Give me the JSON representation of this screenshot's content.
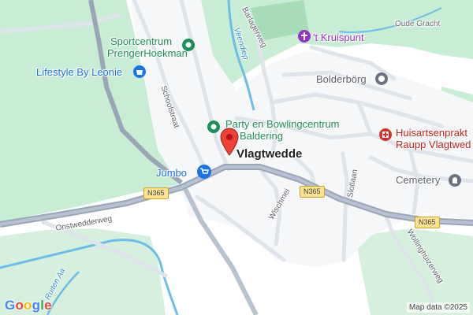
{
  "map": {
    "colors": {
      "land": "#ffffff",
      "park": "#c8edd4",
      "road": "#dfe3ea",
      "major_road": "#9aa6b8",
      "water": "#6cbde9"
    },
    "town_label": "Vlagtwedde",
    "pois": {
      "sportcentrum_line1": "Sportcentrum",
      "sportcentrum_line2": "PrengerHoekman",
      "lifestyle": "Lifestyle By Leonie",
      "kruispunt": "'t Kruispunt",
      "bolderborg": "Bolderbörg",
      "party_line1": "Party en Bowlingcentrum",
      "party_line2": "Baldering",
      "huisarts_line1": "Huisartsenprakt",
      "huisarts_line2": "Raupp Vlagtwed",
      "jumbo": "Jumbo",
      "cemetery": "Cemetery"
    },
    "streets": {
      "schoolstraat": "Schoolstraat",
      "barlagerweg": "Barlagerweg",
      "onstwedderweg": "Onstwedderweg",
      "wischmei": "Wischmei",
      "slotlaan": "Slotlaan",
      "wollinghuizerweg": "Wollinghuizerweg",
      "oude_gracht": "Oude Gracht"
    },
    "water_labels": {
      "veendiep": "Veendiep",
      "ruiten_aa": "Ruiten Aa"
    },
    "shields": {
      "n365_west": "N365",
      "n365_center": "N365",
      "n365_east": "N365"
    },
    "attribution": {
      "logo": "Google",
      "credit": "Map data ©2025"
    },
    "icons": [
      "location-pin-icon",
      "sport-icon",
      "shopping-icon",
      "church-icon",
      "landmark-icon",
      "medical-icon",
      "cemetery-icon"
    ]
  }
}
